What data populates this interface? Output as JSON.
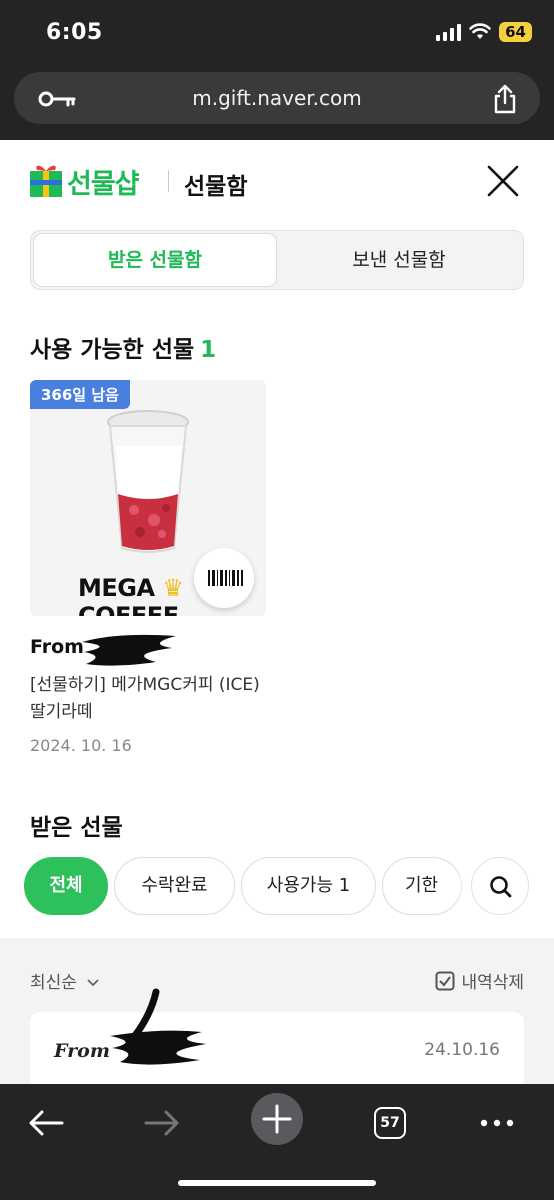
{
  "status": {
    "time": "6:05",
    "battery": "64"
  },
  "browser": {
    "url": "m.gift.naver.com",
    "tab_count": "57"
  },
  "header": {
    "logo_label": "선물샵",
    "title": "선물함"
  },
  "segments": [
    {
      "label": "받은 선물함",
      "active": true
    },
    {
      "label": "보낸 선물함",
      "active": false
    }
  ],
  "available": {
    "title": "사용 가능한 선물",
    "count": "1",
    "card": {
      "dday": "366일 남음",
      "brand": "MEGA",
      "brand_suffix": "COFFEE",
      "from_label": "From",
      "name": "[선물하기] 메가MGC커피 (ICE)딸기라떼",
      "date": "2024. 10. 16"
    }
  },
  "received": {
    "title": "받은 선물",
    "filters": [
      {
        "label": "전체",
        "active": true
      },
      {
        "label": "수락완료",
        "active": false
      },
      {
        "label": "사용가능 1",
        "active": false
      },
      {
        "label": "기한",
        "active": false
      }
    ],
    "sort_label": "최신순",
    "delete_label": "내역삭제",
    "list": [
      {
        "from_label": "From",
        "date": "24.10.16"
      }
    ]
  },
  "colors": {
    "brand_green": "#1fb955",
    "dday_blue": "#4a7fe0",
    "chip_active": "#2ec05a"
  }
}
